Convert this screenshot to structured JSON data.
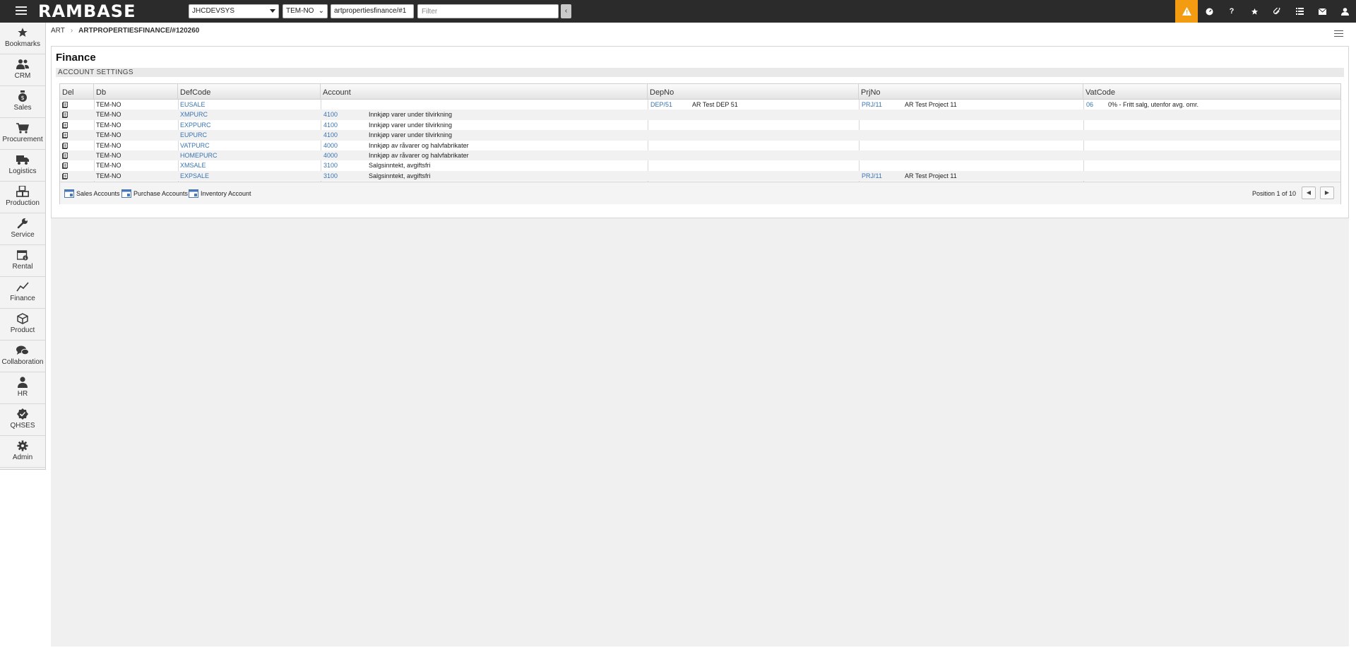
{
  "app": {
    "logo": "RAMBASE"
  },
  "topbar": {
    "company_select": "JHCDEVSYS",
    "db_select": "TEM-NO",
    "url_input": "artpropertiesfinance/#1",
    "filter_placeholder": "Filter",
    "collapse_glyph": "‹",
    "icons": [
      "warning-icon",
      "gauge-icon",
      "help-icon",
      "star-icon",
      "paperclip-icon",
      "list-icon",
      "mail-icon",
      "user-icon"
    ],
    "warning_color": "#f39c12"
  },
  "sidebar": {
    "items": [
      {
        "label": "Bookmarks",
        "icon": "star-icon"
      },
      {
        "label": "CRM",
        "icon": "people-icon"
      },
      {
        "label": "Sales",
        "icon": "money-bag-icon"
      },
      {
        "label": "Procurement",
        "icon": "cart-icon"
      },
      {
        "label": "Logistics",
        "icon": "truck-icon"
      },
      {
        "label": "Production",
        "icon": "boxes-icon"
      },
      {
        "label": "Service",
        "icon": "wrench-icon"
      },
      {
        "label": "Rental",
        "icon": "calendar-icon"
      },
      {
        "label": "Finance",
        "icon": "chart-line-icon"
      },
      {
        "label": "Product",
        "icon": "cube-icon"
      },
      {
        "label": "Collaboration",
        "icon": "chat-icon"
      },
      {
        "label": "HR",
        "icon": "person-icon"
      },
      {
        "label": "QHSES",
        "icon": "badge-check-icon"
      },
      {
        "label": "Admin",
        "icon": "gear-icon"
      }
    ]
  },
  "breadcrumb": {
    "root": "ART",
    "separator": "›",
    "current": "ARTPROPERTIESFINANCE/#120260"
  },
  "panel": {
    "title": "Finance",
    "section": "ACCOUNT SETTINGS"
  },
  "grid": {
    "columns": [
      "Del",
      "Db",
      "DefCode",
      "Account",
      "DepNo",
      "PrjNo",
      "VatCode"
    ],
    "rows": [
      {
        "db": "TEM-NO",
        "defcode": "EUSALE",
        "account": "",
        "account_name": "",
        "depno": "DEP/51",
        "dep_name": "AR Test DEP 51",
        "prjno": "PRJ/11",
        "prj_name": "AR Test Project 11",
        "vatcode": "06",
        "vat_name": "0% - Fritt salg, utenfor avg. omr."
      },
      {
        "db": "TEM-NO",
        "defcode": "XMPURC",
        "account": "4100",
        "account_name": "Innkjøp varer under tilvirkning",
        "depno": "",
        "dep_name": "",
        "prjno": "",
        "prj_name": "",
        "vatcode": "",
        "vat_name": ""
      },
      {
        "db": "TEM-NO",
        "defcode": "EXPPURC",
        "account": "4100",
        "account_name": "Innkjøp varer under tilvirkning",
        "depno": "",
        "dep_name": "",
        "prjno": "",
        "prj_name": "",
        "vatcode": "",
        "vat_name": ""
      },
      {
        "db": "TEM-NO",
        "defcode": "EUPURC",
        "account": "4100",
        "account_name": "Innkjøp varer under tilvirkning",
        "depno": "",
        "dep_name": "",
        "prjno": "",
        "prj_name": "",
        "vatcode": "",
        "vat_name": ""
      },
      {
        "db": "TEM-NO",
        "defcode": "VATPURC",
        "account": "4000",
        "account_name": "Innkjøp av råvarer og halvfabrikater",
        "depno": "",
        "dep_name": "",
        "prjno": "",
        "prj_name": "",
        "vatcode": "",
        "vat_name": ""
      },
      {
        "db": "TEM-NO",
        "defcode": "HOMEPURC",
        "account": "4000",
        "account_name": "Innkjøp av råvarer og halvfabrikater",
        "depno": "",
        "dep_name": "",
        "prjno": "",
        "prj_name": "",
        "vatcode": "",
        "vat_name": ""
      },
      {
        "db": "TEM-NO",
        "defcode": "XMSALE",
        "account": "3100",
        "account_name": "Salgsinntekt, avgiftsfri",
        "depno": "",
        "dep_name": "",
        "prjno": "",
        "prj_name": "",
        "vatcode": "",
        "vat_name": ""
      },
      {
        "db": "TEM-NO",
        "defcode": "EXPSALE",
        "account": "3100",
        "account_name": "Salgsinntekt, avgiftsfri",
        "depno": "",
        "dep_name": "",
        "prjno": "PRJ/11",
        "prj_name": "AR Test Project 11",
        "vatcode": "",
        "vat_name": ""
      }
    ],
    "footer": {
      "buttons": [
        "Sales Accounts",
        "Purchase Accounts",
        "Inventory Account"
      ],
      "position": "Position 1 of 10",
      "prev_glyph": "◀",
      "next_glyph": "▶"
    }
  }
}
